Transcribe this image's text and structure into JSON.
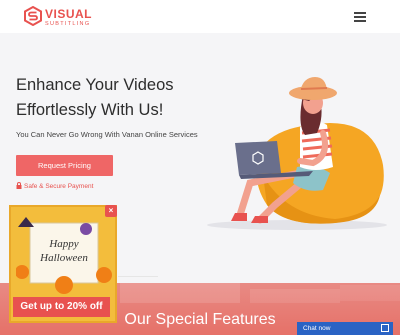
{
  "brand": {
    "name": "VISUAL",
    "tagline": "SUBTITLING",
    "color": "#e8524f"
  },
  "nav": {
    "menu_icon": "hamburger-menu-icon"
  },
  "hero": {
    "headline_line1": "Enhance Your Videos",
    "headline_line2": "Effortlessly With Us!",
    "subtext": "You Can Never Go Wrong With Vanan Online Services",
    "cta_label": "Request Pricing",
    "secure_label": "Safe & Secure Payment",
    "accent": "#ef6666"
  },
  "section": {
    "title": "Our Special Features"
  },
  "promo": {
    "card_line1": "Happy",
    "card_line2": "Halloween",
    "button_label": "Get up to 20% off",
    "close_icon": "close-icon"
  },
  "chat": {
    "label": "Chat now",
    "icon": "chat-window-icon"
  }
}
